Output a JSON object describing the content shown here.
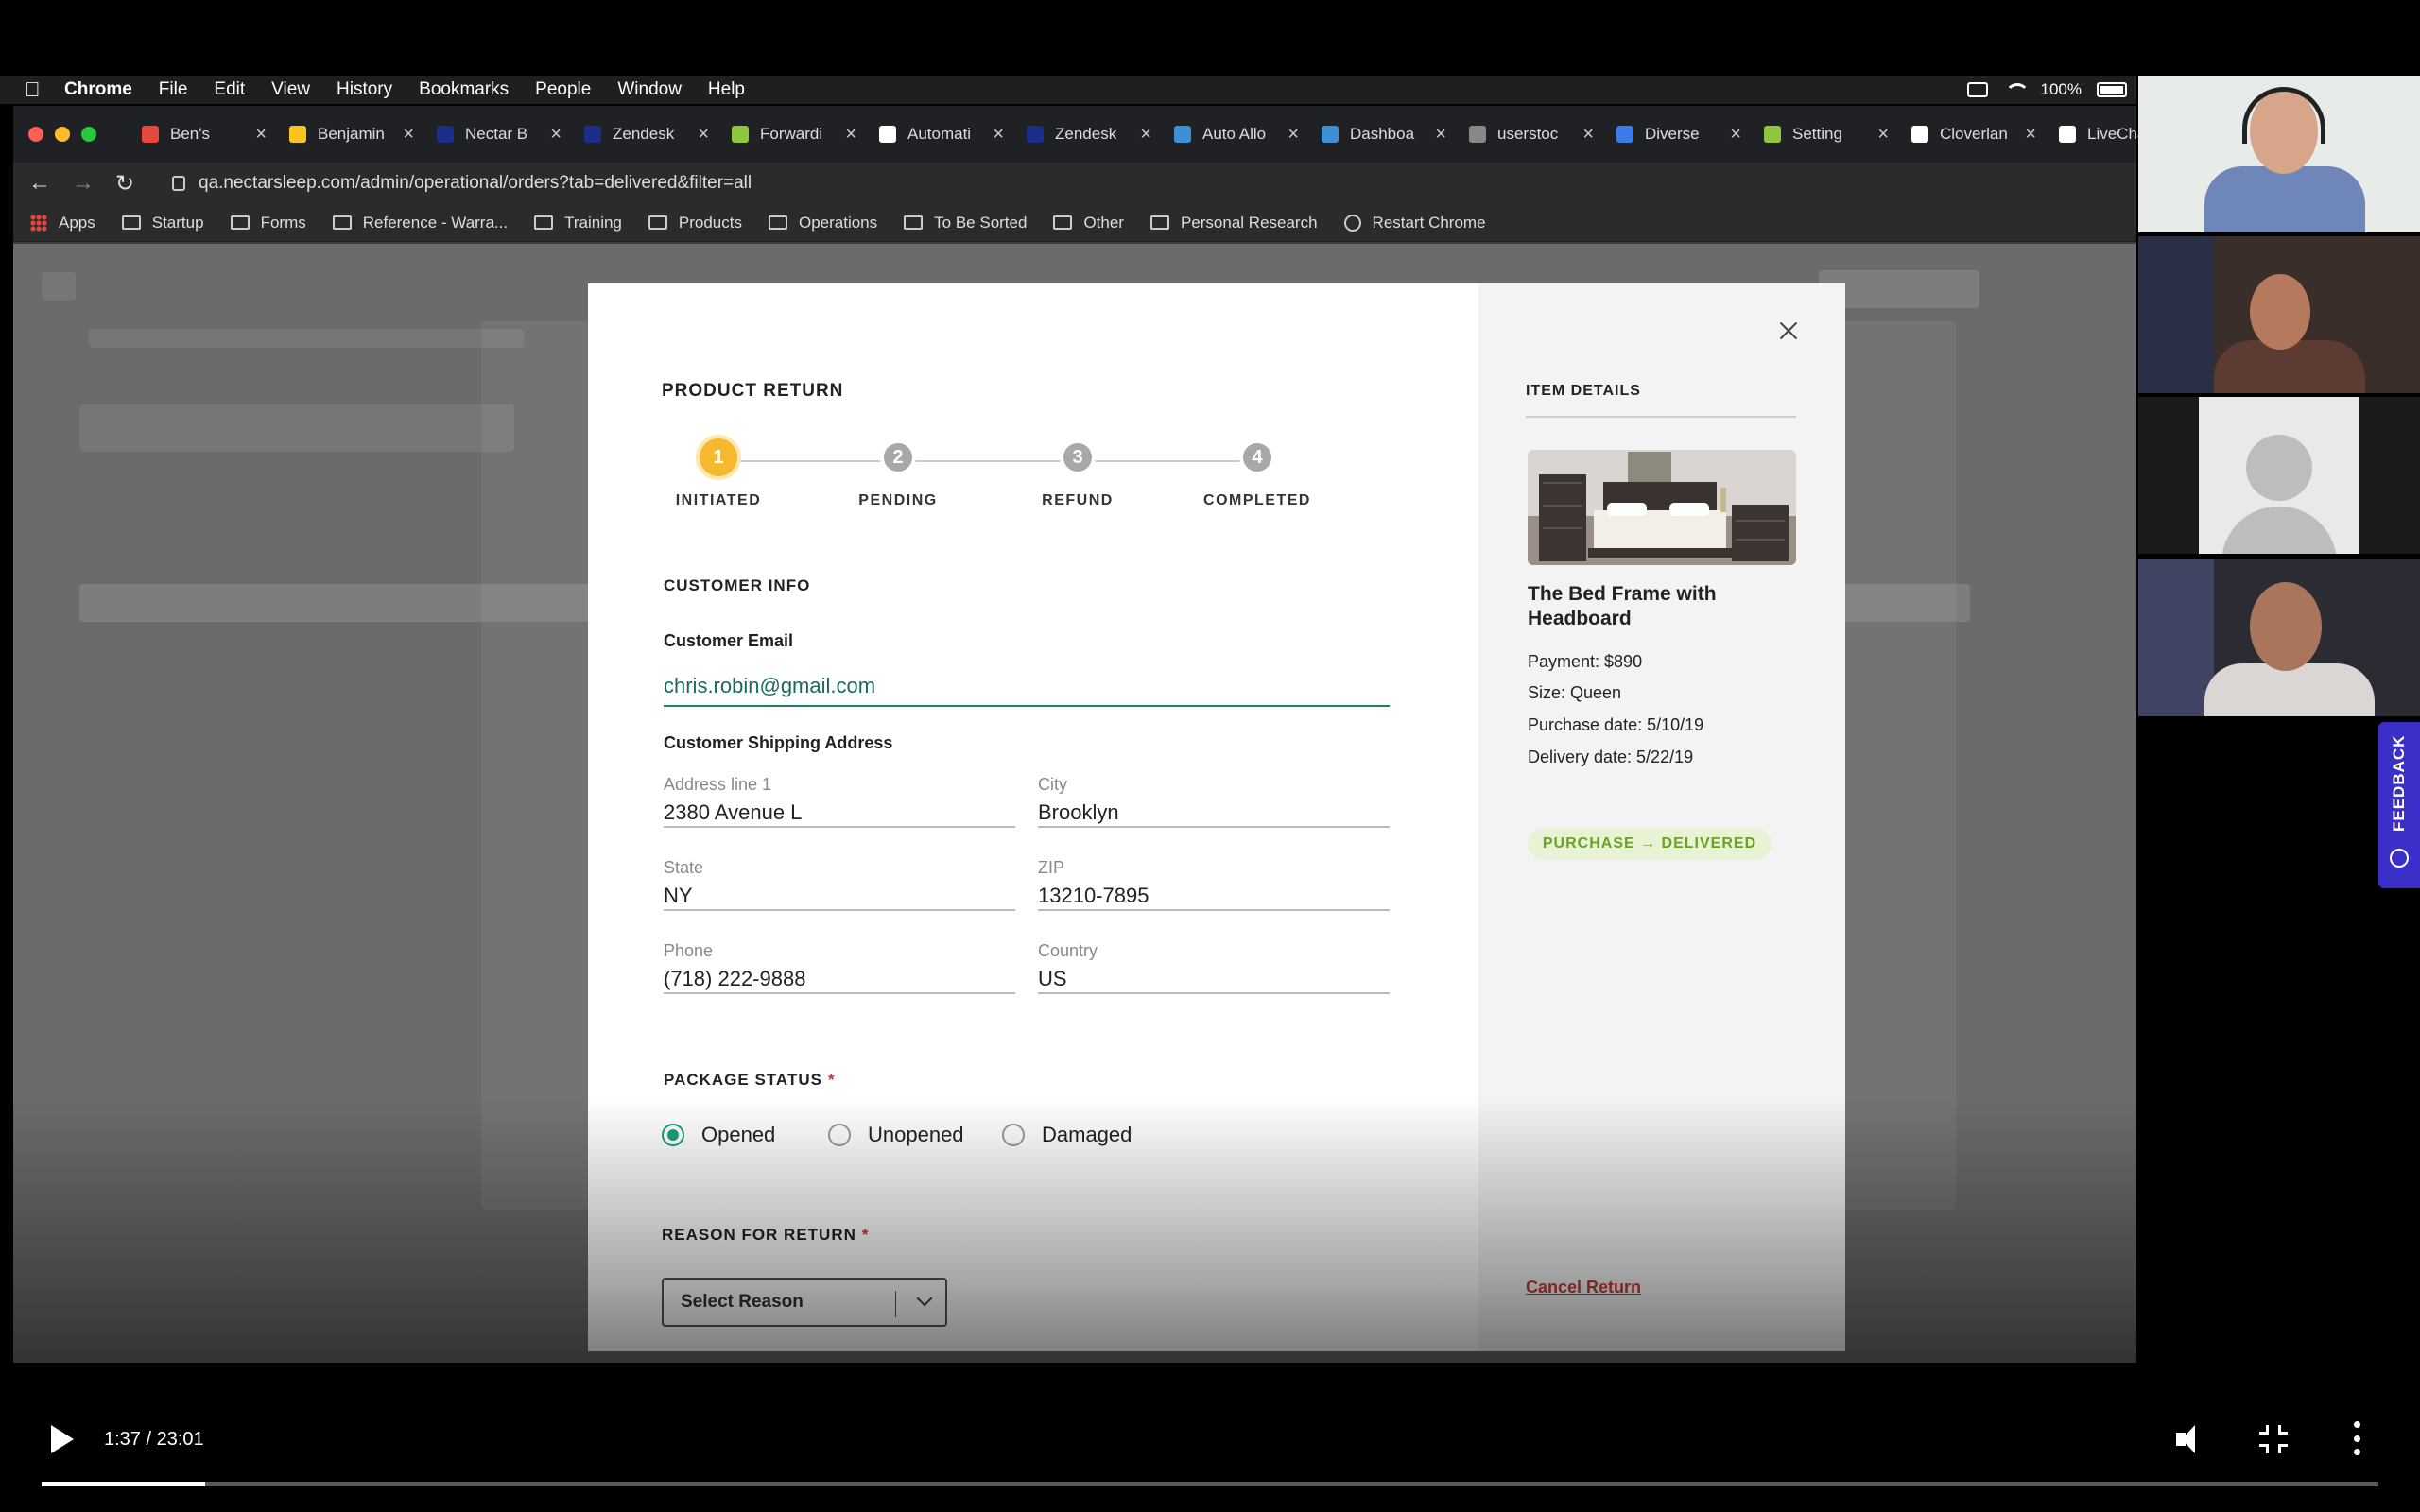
{
  "menubar": {
    "app": "Chrome",
    "items": [
      "File",
      "Edit",
      "View",
      "History",
      "Bookmarks",
      "People",
      "Window",
      "Help"
    ],
    "battery": "100%"
  },
  "browser": {
    "tabs": [
      {
        "title": "Ben's",
        "color": "#e8473c"
      },
      {
        "title": "Benjamin",
        "color": "#f7c51e"
      },
      {
        "title": "Nectar B",
        "color": "#1b2f8a"
      },
      {
        "title": "Zendesk",
        "color": "#1b2f8a"
      },
      {
        "title": "Forwardi",
        "color": "#8ec63f"
      },
      {
        "title": "Automati",
        "color": "#ffffff"
      },
      {
        "title": "Zendesk",
        "color": "#1b2f8a"
      },
      {
        "title": "Auto Allo",
        "color": "#3d8fd6"
      },
      {
        "title": "Dashboa",
        "color": "#3d8fd6"
      },
      {
        "title": "userstoc",
        "color": "#888888"
      },
      {
        "title": "Diverse",
        "color": "#3b7bea"
      },
      {
        "title": "Setting",
        "color": "#8ec63f"
      },
      {
        "title": "Cloverlan",
        "color": "#ffffff"
      },
      {
        "title": "LiveChat",
        "color": "#ffffff"
      }
    ],
    "url": "qa.nectarsleep.com/admin/operational/orders?tab=delivered&filter=all",
    "bookmarks": [
      "Apps",
      "Startup",
      "Forms",
      "Reference - Warra...",
      "Training",
      "Products",
      "Operations",
      "To Be Sorted",
      "Other",
      "Personal Research",
      "Restart Chrome"
    ]
  },
  "modal": {
    "title": "PRODUCT RETURN",
    "steps": [
      {
        "num": "1",
        "label": "INITIATED"
      },
      {
        "num": "2",
        "label": "PENDING"
      },
      {
        "num": "3",
        "label": "REFUND"
      },
      {
        "num": "4",
        "label": "COMPLETED"
      }
    ],
    "customer_info_heading": "CUSTOMER INFO",
    "email_label": "Customer Email",
    "email_value": "chris.robin@gmail.com",
    "shipping_heading": "Customer Shipping Address",
    "address": {
      "line1_label": "Address line 1",
      "line1": "2380 Avenue L",
      "city_label": "City",
      "city": "Brooklyn",
      "state_label": "State",
      "state": "NY",
      "zip_label": "ZIP",
      "zip": "13210-7895",
      "phone_label": "Phone",
      "phone": "(718) 222-9888",
      "country_label": "Country",
      "country": "US"
    },
    "package_status_heading": "PACKAGE STATUS",
    "required_mark": "*",
    "package_options": [
      "Opened",
      "Unopened",
      "Damaged"
    ],
    "package_selected": "Opened",
    "reason_heading": "REASON FOR RETURN",
    "reason_placeholder": "Select Reason"
  },
  "item": {
    "heading": "ITEM DETAILS",
    "name": "The Bed Frame with Headboard",
    "payment": "Payment: $890",
    "size": "Size: Queen",
    "purchase_date": "Purchase date: 5/10/19",
    "delivery_date": "Delivery date: 5/22/19",
    "status": "PURCHASE → DELIVERED",
    "cancel_label": "Cancel Return"
  },
  "feedback_label": "FEEDBACK",
  "player": {
    "time": "1:37 / 23:01",
    "progress": 0.07
  },
  "colors": {
    "accent_green": "#1a9f7f",
    "step_active": "#f5b82e",
    "danger": "#c23a36",
    "feedback": "#3b2fc9"
  }
}
